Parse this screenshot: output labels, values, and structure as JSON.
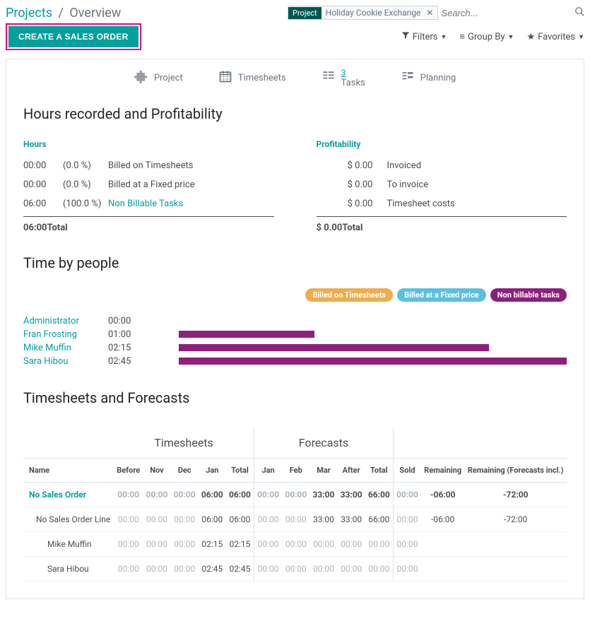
{
  "breadcrumb": {
    "root": "Projects",
    "current": "Overview"
  },
  "search": {
    "tag_label": "Project",
    "tag_value": "Holiday Cookie Exchange",
    "placeholder": "Search..."
  },
  "buttons": {
    "create": "CREATE A SALES ORDER"
  },
  "filters": {
    "filters": "Filters",
    "groupby": "Group By",
    "favorites": "Favorites"
  },
  "stats": {
    "project": "Project",
    "timesheets": "Timesheets",
    "tasks_count": "3",
    "tasks": "Tasks",
    "planning": "Planning"
  },
  "hours_section": {
    "title": "Hours recorded and Profitability",
    "hours_header": "Hours",
    "profitability_header": "Profitability",
    "rows": [
      {
        "time": "00:00",
        "pct": "(0.0 %)",
        "label": "Billed on Timesheets"
      },
      {
        "time": "00:00",
        "pct": "(0.0 %)",
        "label": "Billed at a Fixed price"
      },
      {
        "time": "06:00",
        "pct": "(100.0 %)",
        "label": "Non Billable Tasks"
      }
    ],
    "total_time": "06:00",
    "total_label": "Total",
    "prof_rows": [
      {
        "amt": "$ 0.00",
        "label": "Invoiced"
      },
      {
        "amt": "$ 0.00",
        "label": "To invoice"
      },
      {
        "amt": "$ 0.00",
        "label": "Timesheet costs"
      }
    ],
    "prof_total_amt": "$ 0.00",
    "prof_total_label": "Total"
  },
  "time_people": {
    "title": "Time by people",
    "pills": {
      "orange": "Billed on Timesheets",
      "blue": "Billed at a Fixed price",
      "purple": "Non billable tasks"
    },
    "rows": [
      {
        "name": "Administrator",
        "time": "00:00",
        "bar": 0
      },
      {
        "name": "Fran Frosting",
        "time": "01:00",
        "bar": 35
      },
      {
        "name": "Mike Muffin",
        "time": "02:15",
        "bar": 80
      },
      {
        "name": "Sara Hibou",
        "time": "02:45",
        "bar": 100
      }
    ]
  },
  "tf": {
    "title": "Timesheets and Forecasts",
    "group_headers": {
      "ts": "Timesheets",
      "fc": "Forecasts"
    },
    "cols": {
      "name": "Name",
      "before": "Before",
      "nov": "Nov",
      "dec": "Dec",
      "jan": "Jan",
      "total1": "Total",
      "jan2": "Jan",
      "feb": "Feb",
      "mar": "Mar",
      "after": "After",
      "total2": "Total",
      "sold": "Sold",
      "remaining": "Remaining",
      "remaining_fc": "Remaining (Forecasts incl.)"
    },
    "rows": [
      {
        "name": "No Sales Order",
        "indent": 0,
        "teal": true,
        "before": "00:00",
        "nov": "00:00",
        "dec": "00:00",
        "jan": "06:00",
        "total1": "06:00",
        "jan2": "00:00",
        "feb": "00:00",
        "mar": "33:00",
        "after": "33:00",
        "total2": "66:00",
        "sold": "00:00",
        "remaining": "-06:00",
        "remaining_fc": "-72:00",
        "bold": true
      },
      {
        "name": "No Sales Order Line",
        "indent": 1,
        "before": "00:00",
        "nov": "00:00",
        "dec": "00:00",
        "jan": "06:00",
        "total1": "06:00",
        "jan2": "00:00",
        "feb": "00:00",
        "mar": "33:00",
        "after": "33:00",
        "total2": "66:00",
        "sold": "00:00",
        "remaining": "-06:00",
        "remaining_fc": "-72:00"
      },
      {
        "name": "Mike Muffin",
        "indent": 2,
        "before": "00:00",
        "nov": "00:00",
        "dec": "00:00",
        "jan": "02:15",
        "total1": "02:15",
        "jan2": "00:00",
        "feb": "00:00",
        "mar": "00:00",
        "after": "00:00",
        "total2": "00:00",
        "sold": "00:00",
        "remaining": "",
        "remaining_fc": ""
      },
      {
        "name": "Sara Hibou",
        "indent": 2,
        "before": "00:00",
        "nov": "00:00",
        "dec": "00:00",
        "jan": "02:45",
        "total1": "02:45",
        "jan2": "00:00",
        "feb": "00:00",
        "mar": "00:00",
        "after": "00:00",
        "total2": "00:00",
        "sold": "00:00",
        "remaining": "",
        "remaining_fc": ""
      }
    ]
  },
  "chart_data": {
    "type": "bar",
    "title": "Time by people",
    "categories": [
      "Administrator",
      "Fran Frosting",
      "Mike Muffin",
      "Sara Hibou"
    ],
    "series": [
      {
        "name": "Non billable tasks",
        "values_hhmm": [
          "00:00",
          "01:00",
          "02:15",
          "02:45"
        ],
        "values_minutes": [
          0,
          60,
          135,
          165
        ]
      }
    ],
    "xlabel": "",
    "ylabel": "",
    "orientation": "horizontal"
  }
}
